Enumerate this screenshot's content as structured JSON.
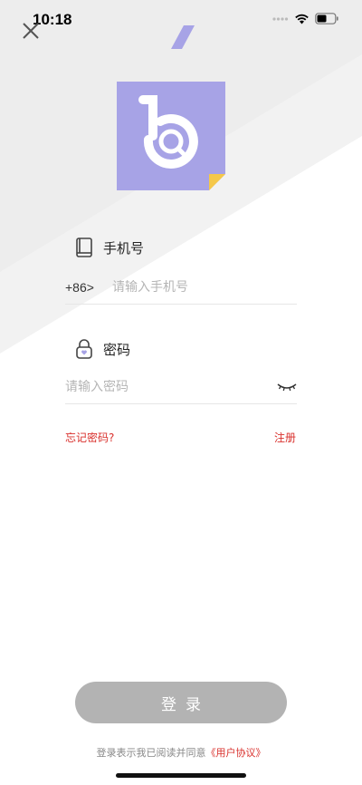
{
  "status_bar": {
    "time": "10:18",
    "icons": [
      "signal-dots-icon",
      "wifi-icon",
      "battery-icon"
    ]
  },
  "header": {
    "close_icon": "close-icon"
  },
  "logo": {
    "icon": "brand-logo",
    "colors": {
      "background": "#a7a3e6",
      "corner": "#f7d36b"
    }
  },
  "phone_section": {
    "label": "手机号",
    "icon": "phone-icon",
    "prefix": "+86>",
    "placeholder": "请输入手机号"
  },
  "password_section": {
    "label": "密码",
    "icon": "lock-icon",
    "placeholder": "请输入密码",
    "toggle_icon": "eye-closed-icon"
  },
  "links": {
    "forgot": "忘记密码?",
    "register": "注册"
  },
  "login_button": {
    "label": "登录"
  },
  "agreement": {
    "prefix": "登录表示我已阅读并同意",
    "link": "《用户协议》"
  },
  "colors": {
    "accent": "#a7a3e6",
    "link_red": "#d9302c",
    "button_disabled": "#b3b3b3"
  }
}
